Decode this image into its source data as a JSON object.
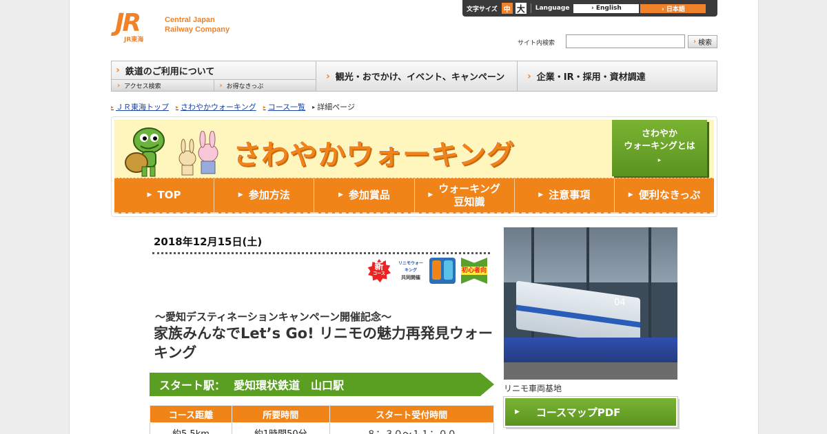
{
  "header": {
    "logo_mark": "JR",
    "logo_sub": "JR東海",
    "company_line1": "Central Japan",
    "company_line2": "Railway Company",
    "font_size_label": "文字サイズ",
    "font_size_mid": "中",
    "font_size_big": "大",
    "language_label": "Language",
    "lang_english": "› English",
    "lang_japanese": "› 日本語",
    "search_label": "サイト内検索",
    "search_value": "",
    "search_button": "検索"
  },
  "gnav": {
    "item1": "鉄道のご利用について",
    "item1_sub1": "アクセス検索",
    "item1_sub2": "お得なきっぷ",
    "item2": "観光・おでかけ、イベント、キャンペーン",
    "item3": "企業・IR・採用・資材調達"
  },
  "breadcrumb": [
    "ＪＲ東海トップ",
    "さわやかウォーキング",
    "コース一覧",
    "詳細ページ"
  ],
  "banner": {
    "title": "さわやかウォーキング",
    "about_line1": "さわやか",
    "about_line2": "ウォーキングとは",
    "about_arrow": "▸",
    "nav": [
      "TOP",
      "参加方法",
      "参加賞品",
      "ウォーキング",
      "豆知識",
      "注意事項",
      "便利なきっぷ"
    ]
  },
  "event": {
    "date": "2018年12月15日(土)",
    "icons": {
      "new_label": "新",
      "new_sub": "コース",
      "linimo_line1": "リニモウォーキング",
      "linimo_line2": "共同開催",
      "beginner": "初心者向"
    },
    "subtitle": "～愛知デスティネーションキャンペーン開催記念～",
    "title": "家族みんなでLet’s Go! リニモの魅力再発見ウォーキング",
    "start_label": "スタート駅：",
    "start_station": "愛知環状鉄道　山口駅",
    "table_headers": [
      "コース距離",
      "所要時間",
      "スタート受付時間"
    ],
    "table_values": [
      "約5.5km",
      "約1時間50分",
      "８：３０～１１：００"
    ]
  },
  "side": {
    "photo_number": "04",
    "caption": "リニモ車両基地",
    "pdf_button": "コースマップPDF"
  },
  "colors": {
    "accent": "#f08419",
    "green": "#5a9e22",
    "banner_bg": "#fff6bd",
    "link": "#1a44a6"
  }
}
